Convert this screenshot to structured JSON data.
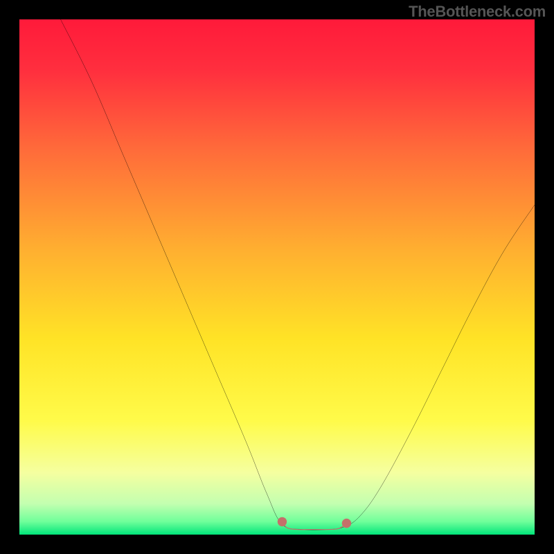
{
  "watermark": "TheBottleneck.com",
  "chart_data": {
    "type": "line",
    "title": "",
    "xlabel": "",
    "ylabel": "",
    "xlim": [
      0,
      100
    ],
    "ylim": [
      0,
      100
    ],
    "gradient_stops": [
      {
        "offset": 0.0,
        "color": "#ff1a3a"
      },
      {
        "offset": 0.1,
        "color": "#ff2f3e"
      },
      {
        "offset": 0.25,
        "color": "#ff6a3a"
      },
      {
        "offset": 0.45,
        "color": "#ffb030"
      },
      {
        "offset": 0.62,
        "color": "#ffe326"
      },
      {
        "offset": 0.78,
        "color": "#fffb4a"
      },
      {
        "offset": 0.88,
        "color": "#f5ffa0"
      },
      {
        "offset": 0.94,
        "color": "#c3ffb0"
      },
      {
        "offset": 0.975,
        "color": "#6fff9a"
      },
      {
        "offset": 1.0,
        "color": "#00e57a"
      }
    ],
    "series": [
      {
        "name": "bottleneck-curve",
        "stroke": "#000000",
        "points": [
          {
            "x": 8,
            "y": 100
          },
          {
            "x": 14,
            "y": 88
          },
          {
            "x": 20,
            "y": 74
          },
          {
            "x": 26,
            "y": 60
          },
          {
            "x": 32,
            "y": 46
          },
          {
            "x": 38,
            "y": 32
          },
          {
            "x": 44,
            "y": 18
          },
          {
            "x": 48,
            "y": 8
          },
          {
            "x": 51,
            "y": 2
          },
          {
            "x": 55,
            "y": 1
          },
          {
            "x": 60,
            "y": 1
          },
          {
            "x": 63,
            "y": 1.5
          },
          {
            "x": 66,
            "y": 3.5
          },
          {
            "x": 70,
            "y": 9
          },
          {
            "x": 76,
            "y": 20
          },
          {
            "x": 82,
            "y": 32
          },
          {
            "x": 88,
            "y": 44
          },
          {
            "x": 94,
            "y": 55
          },
          {
            "x": 100,
            "y": 64
          }
        ]
      },
      {
        "name": "optimal-band",
        "stroke": "#c4706a",
        "points": [
          {
            "x": 51,
            "y": 2.5
          },
          {
            "x": 52,
            "y": 1.3
          },
          {
            "x": 54,
            "y": 1.0
          },
          {
            "x": 57,
            "y": 1.0
          },
          {
            "x": 60,
            "y": 1.0
          },
          {
            "x": 62,
            "y": 1.2
          },
          {
            "x": 63.5,
            "y": 2.2
          }
        ]
      }
    ],
    "markers": [
      {
        "x": 51,
        "y": 2.5,
        "color": "#c4706a"
      },
      {
        "x": 63.5,
        "y": 2.2,
        "color": "#c4706a"
      }
    ]
  }
}
